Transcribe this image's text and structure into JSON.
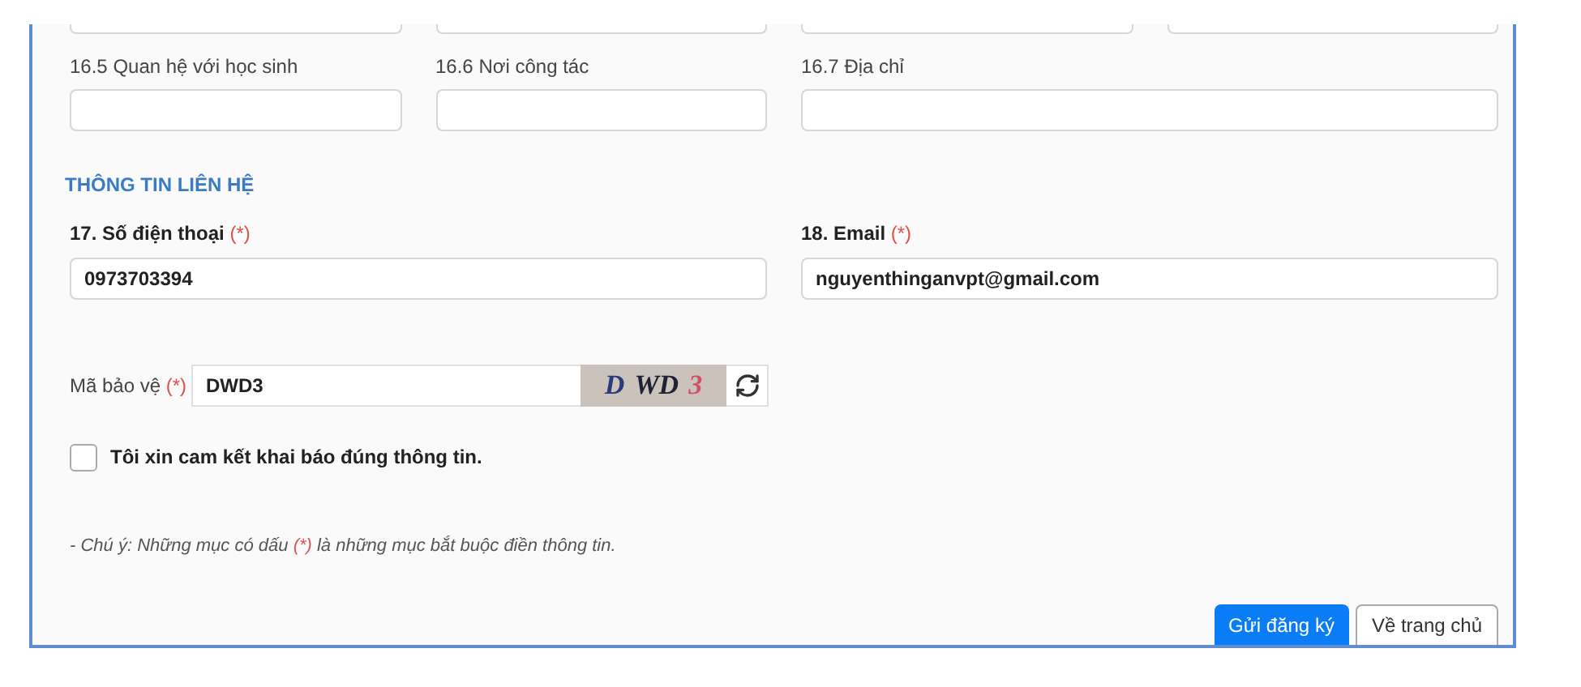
{
  "cut_fields": [
    {
      "kind": "text"
    },
    {
      "kind": "text"
    },
    {
      "kind": "text"
    },
    {
      "kind": "text"
    }
  ],
  "guardian_fields": [
    {
      "label": "16.5 Quan hệ với học sinh"
    },
    {
      "label": "16.6 Nơi công tác"
    },
    {
      "label": "16.7 Địa chỉ"
    }
  ],
  "contact_section": {
    "title": "THÔNG TIN LIÊN HỆ",
    "fields": [
      {
        "label": "17. Số điện thoại",
        "required_mark": "(*)",
        "value": "0973703394"
      },
      {
        "label": "18. Email",
        "required_mark": "(*)",
        "value": "nguyenthinganvpt@gmail.com"
      }
    ]
  },
  "captcha": {
    "label": "Mã bảo vệ",
    "required_mark": "(*)",
    "value": "DWD3",
    "image_chars": [
      {
        "char": "D",
        "color": "#2a3a7a"
      },
      {
        "char": "WD",
        "color": "#1e2233"
      },
      {
        "char": "3",
        "color": "#d0506a"
      }
    ]
  },
  "commitment": {
    "label": "Tôi xin cam kết khai báo đúng thông tin.",
    "checked": false
  },
  "note": "- Chú ý: Những mục có dấu **(*)** là những mục bắt buộc điền thông tin.",
  "buttons": [
    {
      "label": "Gửi đăng ký",
      "kind": "primary"
    },
    {
      "label": "Về trang chủ",
      "kind": "secondary"
    }
  ]
}
